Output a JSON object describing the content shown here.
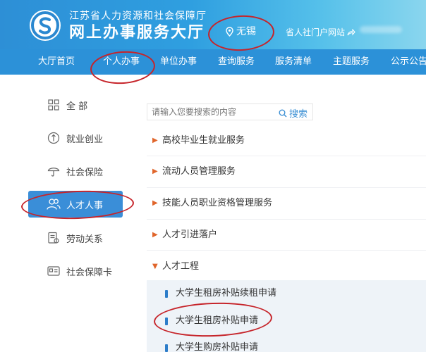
{
  "header": {
    "org": "江苏省人力资源和社会保障厅",
    "title": "网上办事服务大厅",
    "location": "无锡",
    "portal_link": "省人社门户网站"
  },
  "nav": {
    "items": [
      "大厅首页",
      "个人办事",
      "单位办事",
      "查询服务",
      "服务清单",
      "主题服务",
      "公示公告"
    ],
    "active": "个人办事"
  },
  "sidebar": {
    "items": [
      {
        "label": "全 部",
        "icon": "grid-icon"
      },
      {
        "label": "就业创业",
        "icon": "employment-icon"
      },
      {
        "label": "社会保险",
        "icon": "umbrella-icon"
      },
      {
        "label": "人才人事",
        "icon": "people-icon"
      },
      {
        "label": "劳动关系",
        "icon": "document-icon"
      },
      {
        "label": "社会保障卡",
        "icon": "card-icon"
      }
    ],
    "active": "人才人事"
  },
  "search": {
    "placeholder": "请输入您要搜索的内容",
    "button": "搜索"
  },
  "categories": [
    {
      "label": "高校毕业生就业服务",
      "expanded": false
    },
    {
      "label": "流动人员管理服务",
      "expanded": false
    },
    {
      "label": "技能人员职业资格管理服务",
      "expanded": false
    },
    {
      "label": "人才引进落户",
      "expanded": false
    },
    {
      "label": "人才工程",
      "expanded": true
    }
  ],
  "subitems": [
    "大学生租房补贴续租申请",
    "大学生租房补贴申请",
    "大学生购房补贴申请"
  ],
  "colors": {
    "header_start": "#2d8fd6",
    "nav": "#2c91d8",
    "active_side": "#3a8ed8",
    "annotation": "#c6242a",
    "triangle": "#e0652b"
  }
}
